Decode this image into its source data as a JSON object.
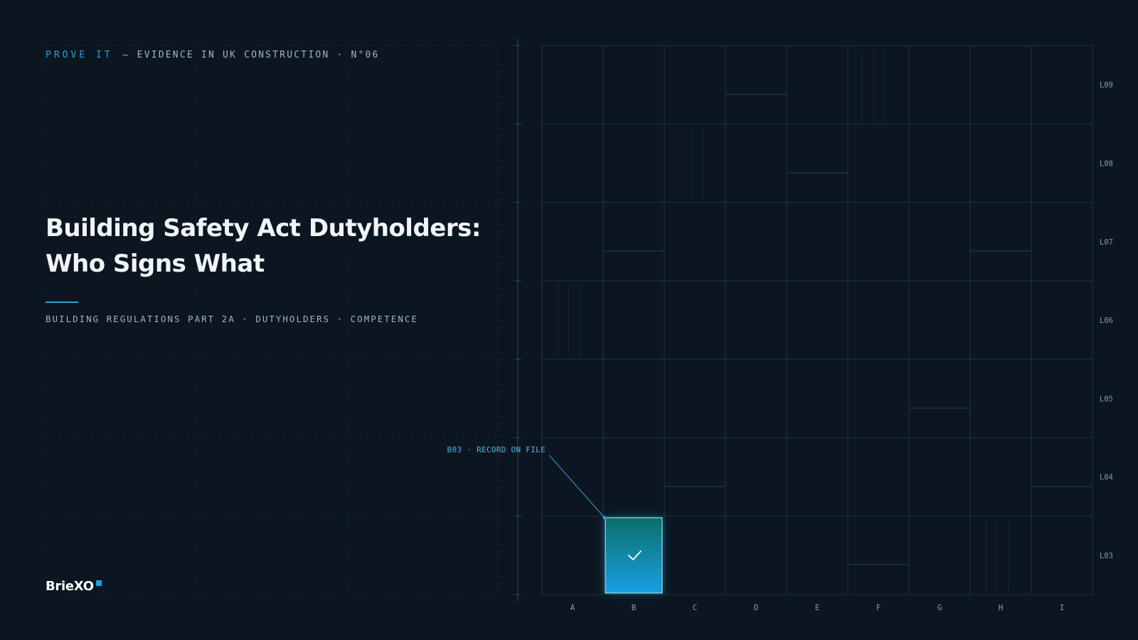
{
  "header": {
    "series": "PROVE IT",
    "tagline": "— EVIDENCE IN UK CONSTRUCTION · N°06"
  },
  "title": {
    "line1": "Building Safety Act Dutyholders:",
    "line2": "Who Signs What"
  },
  "subtitle": "BUILDING REGULATIONS PART 2A · DUTYHOLDERS · COMPETENCE",
  "brand": {
    "name": "BrieXO"
  },
  "grid": {
    "columns": [
      "A",
      "B",
      "C",
      "D",
      "E",
      "F",
      "G",
      "H",
      "I"
    ],
    "levels": [
      "L09",
      "L08",
      "L07",
      "L06",
      "L05",
      "L04",
      "L03"
    ],
    "highlight": {
      "column": "B",
      "level": "L03",
      "label": "B03 · RECORD ON FILE",
      "status_icon": "check-icon"
    }
  },
  "colors": {
    "background": "#0b1620",
    "accent": "#2d9fd8",
    "grid_line": "#23323d",
    "cell_gradient_top": "#0b6e6a",
    "cell_gradient_bottom": "#1aa0e4"
  }
}
